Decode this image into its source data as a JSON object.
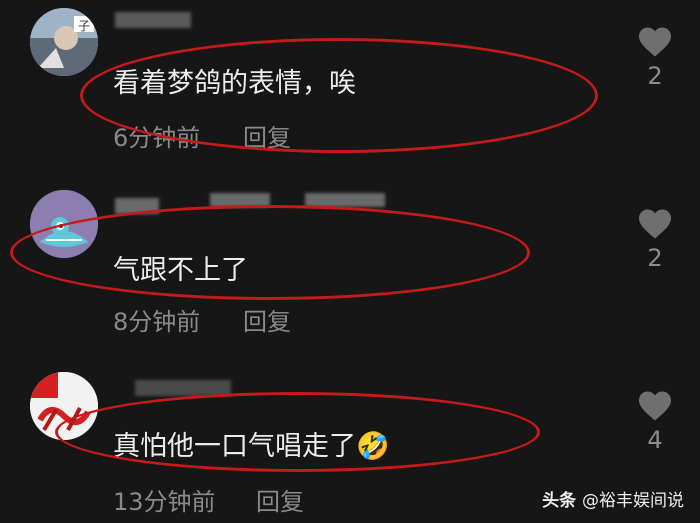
{
  "comments": [
    {
      "text": "看着梦鸽的表情，唉",
      "time": "6分钟前",
      "reply": "回复",
      "likes": "2"
    },
    {
      "text": "气跟不上了",
      "time": "8分钟前",
      "reply": "回复",
      "likes": "2"
    },
    {
      "text": "真怕他一口气唱走了",
      "emoji": "🤣",
      "time": "13分钟前",
      "reply": "回复",
      "likes": "4"
    }
  ],
  "watermark": {
    "platform": "头条",
    "account": "@裕丰娱间说"
  },
  "colors": {
    "background": "#161616",
    "highlight_oval": "#c51a1a"
  }
}
